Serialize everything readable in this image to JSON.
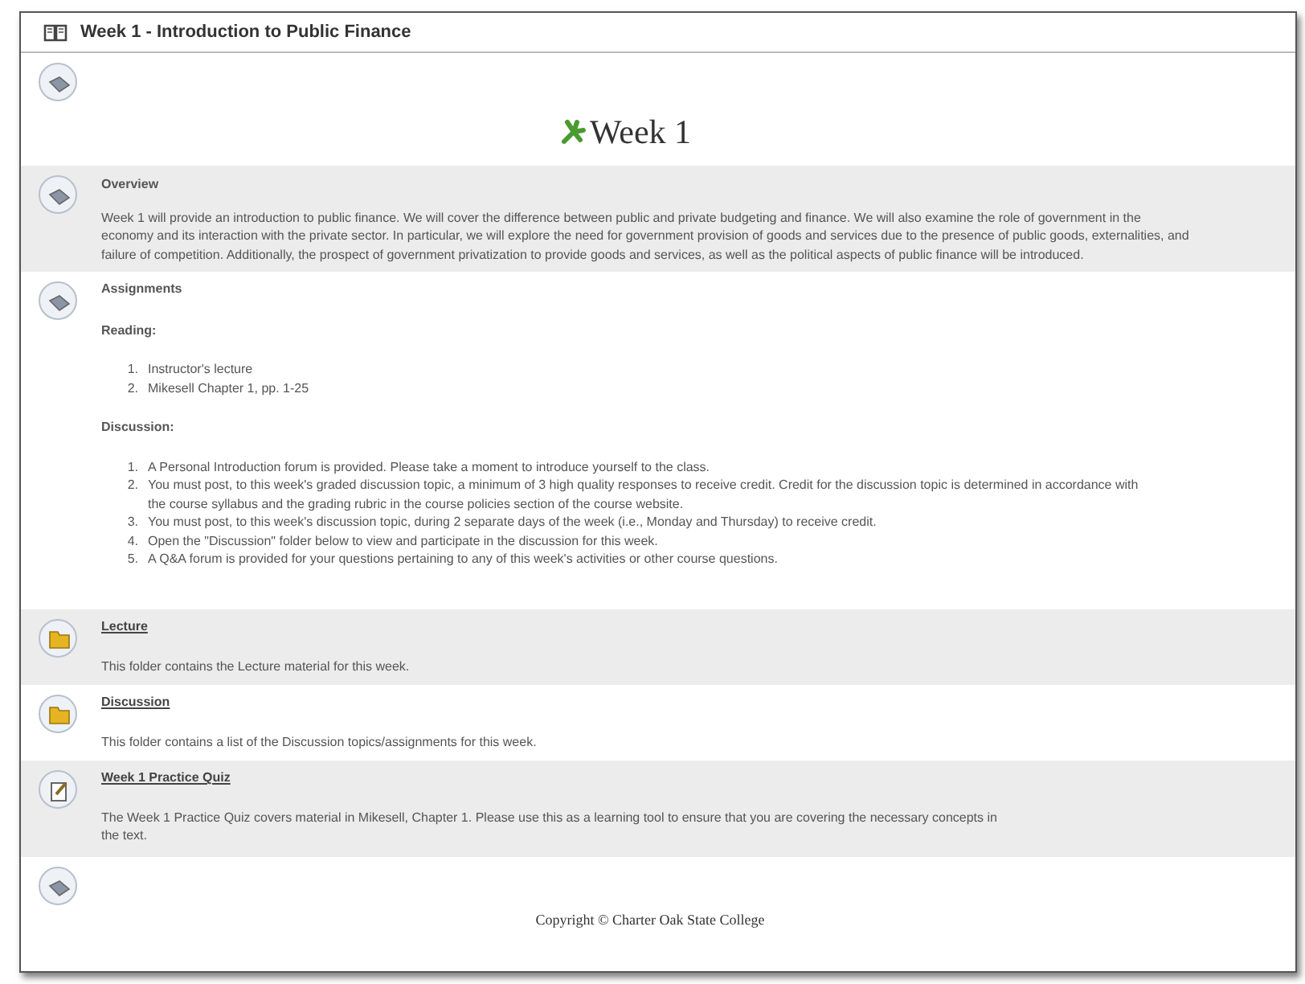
{
  "window": {
    "title": "Week 1 - Introduction to Public Finance"
  },
  "items": [
    {
      "kind": "banner",
      "shaded": false,
      "heading": "Week 1"
    },
    {
      "kind": "text",
      "shaded": true,
      "title": "Overview",
      "body": "Week 1 will provide an introduction to public finance.  We will cover the difference between public and private budgeting and finance.  We will also examine the role of government in the economy and its interaction with the private sector.  In particular, we will explore the need for government provision of goods and services due to the presence of public goods, externalities, and failure of competition.  Additionally, the prospect of government privatization to provide goods and services, as well as the political aspects of public finance will be introduced."
    },
    {
      "kind": "assignments",
      "shaded": false,
      "title": "Assignments",
      "groups": [
        {
          "label": "Reading:",
          "entries": [
            {
              "number": "1.",
              "text": "Instructor's lecture"
            },
            {
              "number": "2.",
              "text": "Mikesell Chapter 1, pp. 1-25"
            }
          ]
        },
        {
          "label": "Discussion:",
          "entries": [
            {
              "number": "1.",
              "text": "A Personal Introduction forum is provided.  Please take a moment to introduce yourself to the class."
            },
            {
              "number": "2.",
              "text": "You must post, to this week's graded discussion topic, a minimum of 3 high quality responses to receive credit. Credit for the discussion topic is determined in accordance with the course syllabus and the grading rubric in the course policies section of the course website."
            },
            {
              "number": "3.",
              "text": "You must post, to this week's discussion topic, during 2 separate days of the week (i.e., Monday and Thursday) to receive credit."
            },
            {
              "number": "4.",
              "text": "Open the \"Discussion\" folder below to view and participate in the discussion for this week."
            },
            {
              "number": "5.",
              "text": "A Q&A forum is provided for your questions pertaining to any of this week's activities or other course questions."
            }
          ]
        }
      ]
    },
    {
      "kind": "folder",
      "shaded": true,
      "title": "Lecture",
      "body": "This folder contains the Lecture material for this week."
    },
    {
      "kind": "folder",
      "shaded": false,
      "title": "Discussion",
      "body": "This folder contains a list of the Discussion topics/assignments for this week."
    },
    {
      "kind": "quiz",
      "shaded": true,
      "title": "Week 1 Practice Quiz",
      "body": "The Week 1 Practice Quiz covers material in Mikesell, Chapter 1. Please use this as a learning tool to ensure that you are covering the necessary concepts in the text."
    },
    {
      "kind": "footer",
      "shaded": false,
      "text": "Copyright © Charter Oak State College"
    }
  ]
}
